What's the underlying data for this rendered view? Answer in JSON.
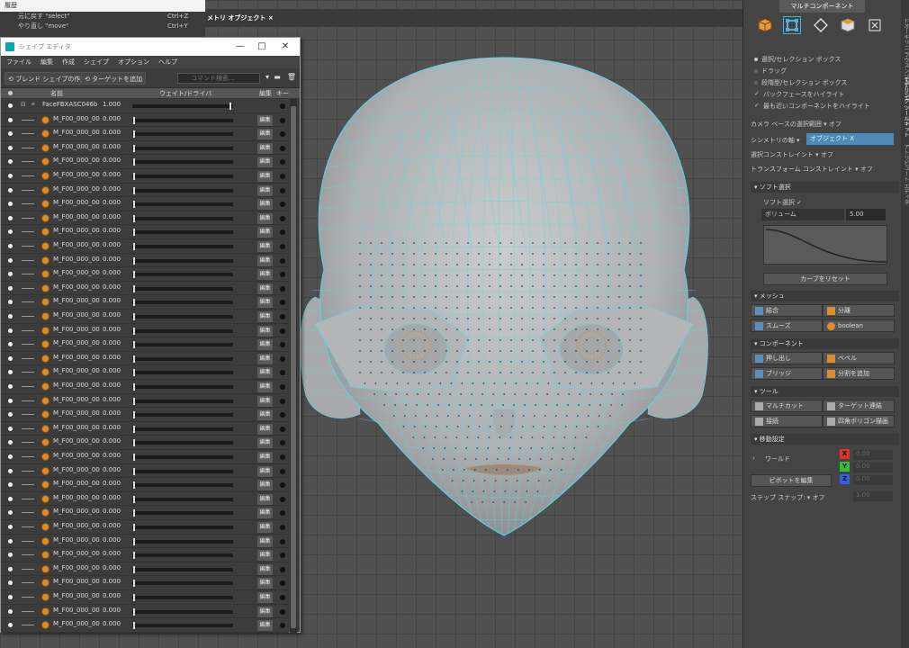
{
  "viewport": {
    "top_title": "メトリ オブジェクト ×"
  },
  "history": {
    "title": "履歴",
    "rows": [
      {
        "label": "元に戻す \"select\"",
        "shortcut": "Ctrl+Z"
      },
      {
        "label": "やり直し \"move\"",
        "shortcut": "Ctrl+Y"
      }
    ]
  },
  "shape_editor": {
    "title": "シェイプ エディタ",
    "minimize": "—",
    "maximize": "□",
    "close": "✕",
    "menus": [
      "ファイル",
      "編集",
      "作成",
      "シェイプ",
      "オプション",
      "ヘルプ"
    ],
    "toolbar": {
      "blend_shape_btn": "ブレンド シェイプの作成",
      "add_target_btn": "ターゲットを追加",
      "search_placeholder": "コマンド検索..."
    },
    "columns": {
      "name": "名前",
      "weight": "ウェイト/ドライバ",
      "edit": "編集",
      "key": "キー"
    },
    "root_row": {
      "name": "FaceFBXASC046b",
      "value": "1.000"
    },
    "rows": [
      {
        "name": "M_F00_000_00",
        "value": "0.000",
        "edit": "編集"
      },
      {
        "name": "M_F00_000_00",
        "value": "0.000",
        "edit": "編集"
      },
      {
        "name": "M_F00_000_00",
        "value": "0.000",
        "edit": "編集"
      },
      {
        "name": "M_F00_000_00",
        "value": "0.000",
        "edit": "編集"
      },
      {
        "name": "M_F00_000_00",
        "value": "0.000",
        "edit": "編集"
      },
      {
        "name": "M_F00_000_00",
        "value": "0.000",
        "edit": "編集"
      },
      {
        "name": "M_F00_000_00",
        "value": "0.000",
        "edit": "編集"
      },
      {
        "name": "M_F00_000_00",
        "value": "0.000",
        "edit": "編集"
      },
      {
        "name": "M_F00_000_00",
        "value": "0.000",
        "edit": "編集"
      },
      {
        "name": "M_F00_000_00",
        "value": "0.000",
        "edit": "編集"
      },
      {
        "name": "M_F00_000_00",
        "value": "0.000",
        "edit": "編集"
      },
      {
        "name": "M_F00_000_00",
        "value": "0.000",
        "edit": "編集"
      },
      {
        "name": "M_F00_000_00",
        "value": "0.000",
        "edit": "編集"
      },
      {
        "name": "M_F00_000_00",
        "value": "0.000",
        "edit": "編集"
      },
      {
        "name": "M_F00_000_00",
        "value": "0.000",
        "edit": "編集"
      },
      {
        "name": "M_F00_000_00",
        "value": "0.000",
        "edit": "編集"
      },
      {
        "name": "M_F00_000_00",
        "value": "0.000",
        "edit": "編集"
      },
      {
        "name": "M_F00_000_00",
        "value": "0.000",
        "edit": "編集"
      },
      {
        "name": "M_F00_000_00",
        "value": "0.000",
        "edit": "編集"
      },
      {
        "name": "M_F00_000_00",
        "value": "0.000",
        "edit": "編集"
      },
      {
        "name": "M_F00_000_00",
        "value": "0.000",
        "edit": "編集"
      },
      {
        "name": "M_F00_000_00",
        "value": "0.000",
        "edit": "編集"
      },
      {
        "name": "M_F00_000_00",
        "value": "0.000",
        "edit": "編集"
      },
      {
        "name": "M_F00_000_00",
        "value": "0.000",
        "edit": "編集"
      },
      {
        "name": "M_F00_000_00",
        "value": "0.000",
        "edit": "編集"
      },
      {
        "name": "M_F00_000_00",
        "value": "0.000",
        "edit": "編集"
      },
      {
        "name": "M_F00_000_00",
        "value": "0.000",
        "edit": "編集"
      },
      {
        "name": "M_F00_000_00",
        "value": "0.000",
        "edit": "編集"
      },
      {
        "name": "M_F00_000_00",
        "value": "0.000",
        "edit": "編集"
      },
      {
        "name": "M_F00_000_00",
        "value": "0.000",
        "edit": "編集"
      },
      {
        "name": "M_F00_000_00",
        "value": "0.000",
        "edit": "編集"
      },
      {
        "name": "M_F00_000_00",
        "value": "0.000",
        "edit": "編集"
      },
      {
        "name": "M_F00_000_00",
        "value": "0.000",
        "edit": "編集"
      },
      {
        "name": "M_F00_000_00",
        "value": "0.000",
        "edit": "編集"
      },
      {
        "name": "M_F00_000_00",
        "value": "0.000",
        "edit": "編集"
      },
      {
        "name": "M_F00_000_00",
        "value": "0.000",
        "edit": "編集"
      },
      {
        "name": "M_F00_000_00",
        "value": "0.000",
        "edit": "編集"
      }
    ]
  },
  "right_panel": {
    "title": "マルチコンポーネント",
    "vertical_tabs": [
      "ドオーキリニ ラウスンゾルトレエ",
      "モデリング ツールキット",
      "アトリビュート エディタ"
    ],
    "select_modes": [
      "選択/セレクション ボックス",
      "ドラッグ",
      "段階型/セレクション ボックス"
    ],
    "checks": [
      "バックフェースをハイライト",
      "最も近いコンポーネントをハイライト"
    ],
    "camera_label": "カメラ ベースの選択範囲 ▾ オフ",
    "symmetry_label": "シンメトリの軸 ▾",
    "symmetry_value": "オブジェクト X",
    "select_constraint": "選択コンストレイント ▾ オフ",
    "transform_constraint": "トランスフォーム コンストレイント ▾ オフ",
    "soft_select": {
      "section": "ソフト選択",
      "enabled_label": "ソフト選択 ✓",
      "mode": "ボリューム",
      "value": "5.00",
      "reset": "カーブをリセット"
    },
    "mesh": {
      "section": "メッシュ",
      "buttons": [
        "結合",
        "分離",
        "スムーズ",
        "boolean"
      ]
    },
    "component": {
      "section": "コンポーネント",
      "buttons": [
        "押し出し",
        "ベベル",
        "ブリッジ",
        "分割を追加"
      ]
    },
    "tools": {
      "section": "ツール",
      "buttons": [
        "マルチカット",
        "ターゲット連結",
        "接続",
        "四角ポリゴン描画"
      ]
    },
    "move_settings": {
      "section": "移動設定",
      "space": "ワールド",
      "pivot_btn": "ピボットを編集",
      "axes": [
        "X",
        "Y",
        "Z"
      ],
      "values": [
        "0.00",
        "0.00",
        "0.00"
      ],
      "step_label": "ステップ スナップ: ▾ オフ",
      "step_value": "1.00"
    }
  },
  "colors": {
    "wire": "#5fd3e8",
    "mesh": "#b9bcbf",
    "panel": "#444444",
    "accent": "#4f89b8"
  }
}
